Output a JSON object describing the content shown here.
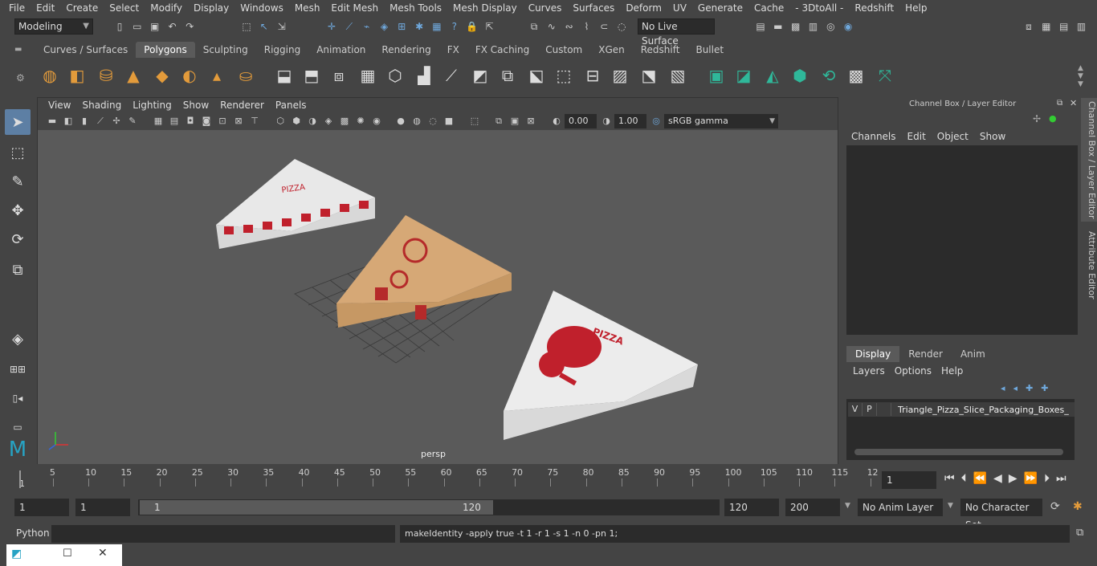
{
  "menubar": [
    "File",
    "Edit",
    "Create",
    "Select",
    "Modify",
    "Display",
    "Windows",
    "Mesh",
    "Edit Mesh",
    "Mesh Tools",
    "Mesh Display",
    "Curves",
    "Surfaces",
    "Deform",
    "UV",
    "Generate",
    "Cache",
    "- 3DtoAll -",
    "Redshift",
    "Help"
  ],
  "mode_dropdown": "Modeling",
  "live_surface": "No Live Surface",
  "shelf_tabs": [
    "Curves / Surfaces",
    "Polygons",
    "Sculpting",
    "Rigging",
    "Animation",
    "Rendering",
    "FX",
    "FX Caching",
    "Custom",
    "XGen",
    "Redshift",
    "Bullet"
  ],
  "shelf_active": "Polygons",
  "viewport": {
    "menu": [
      "View",
      "Shading",
      "Lighting",
      "Show",
      "Renderer",
      "Panels"
    ],
    "exposure": "0.00",
    "gamma": "1.00",
    "color_space": "sRGB gamma",
    "camera_label": "persp"
  },
  "channel_box": {
    "title": "Channel Box / Layer Editor",
    "menu": [
      "Channels",
      "Edit",
      "Object",
      "Show"
    ],
    "tabs": [
      "Display",
      "Render",
      "Anim"
    ],
    "active_tab": "Display",
    "layer_menu": [
      "Layers",
      "Options",
      "Help"
    ],
    "layer": {
      "v": "V",
      "p": "P",
      "name": "Triangle_Pizza_Slice_Packaging_Boxes_"
    }
  },
  "side_tabs": [
    "Channel Box / Layer Editor",
    "Attribute Editor"
  ],
  "timeline": {
    "ticks": [
      "5",
      "10",
      "15",
      "20",
      "25",
      "30",
      "35",
      "40",
      "45",
      "50",
      "55",
      "60",
      "65",
      "70",
      "75",
      "80",
      "85",
      "90",
      "95",
      "100",
      "105",
      "110",
      "115",
      "12"
    ],
    "start_marker": "1",
    "current_frame": "1"
  },
  "range": {
    "start": "1",
    "playback_start": "1",
    "slider_start": "1",
    "slider_end": "120",
    "end": "120",
    "anim_end": "200",
    "anim_layer": "No Anim Layer",
    "char_set": "No Character Set"
  },
  "command": {
    "language": "Python",
    "output": "makeIdentity -apply true -t 1 -r 1 -s 1 -n 0 -pn 1;"
  }
}
